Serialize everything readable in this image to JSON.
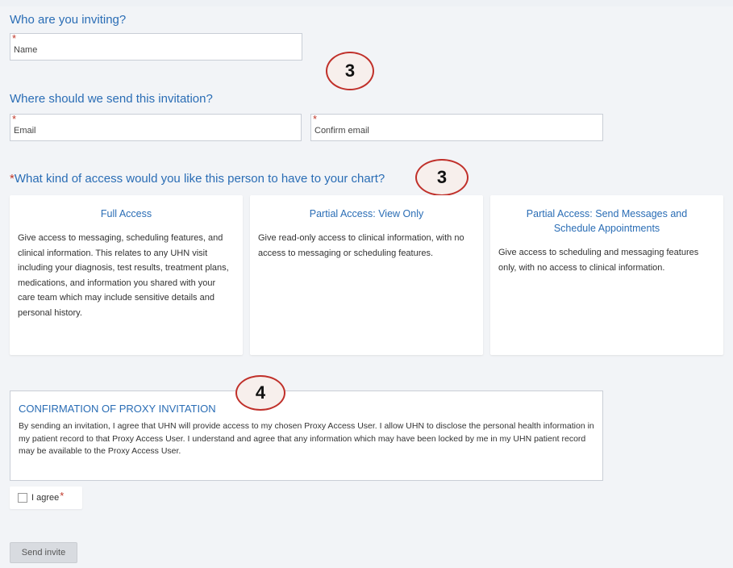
{
  "who_section": {
    "title": "Who are you inviting?",
    "name_placeholder": "Name",
    "required_marker": "*"
  },
  "where_section": {
    "title": "Where should we send this invitation?",
    "email_placeholder": "Email",
    "confirm_email_placeholder": "Confirm email",
    "required_marker": "*"
  },
  "access_section": {
    "required_marker": "*",
    "title": "What kind of access would you like this person to have to your chart?",
    "options": [
      {
        "title": "Full Access",
        "description": "Give access to messaging, scheduling features, and clinical information. This relates to any UHN visit including your diagnosis, test results, treatment plans, medications, and information you shared with your care team which may include sensitive details and personal history."
      },
      {
        "title": "Partial Access: View Only",
        "description": "Give read-only access to clinical information, with no access to messaging or scheduling features."
      },
      {
        "title": "Partial Access: Send Messages and Schedule Appointments",
        "description": "Give access to scheduling and messaging features only, with no access to clinical information."
      }
    ]
  },
  "annotations": {
    "badge_1": "3",
    "badge_2": "3",
    "badge_3": "4",
    "badge_color": "#c0302a"
  },
  "confirmation": {
    "title": "CONFIRMATION OF PROXY INVITATION",
    "text": "By sending an invitation, I agree that UHN will provide access to my chosen Proxy Access User. I allow UHN to disclose the personal health information in my patient record to that Proxy Access User. I understand and agree that any information which may have been locked by me in my UHN patient record may be available to the Proxy Access User.",
    "agree_label": "I agree",
    "agree_required": "*",
    "agree_checked": false
  },
  "actions": {
    "send_label": "Send invite"
  },
  "colors": {
    "accent": "#2a6db5",
    "required": "#c0392b",
    "background": "#f2f4f7"
  }
}
